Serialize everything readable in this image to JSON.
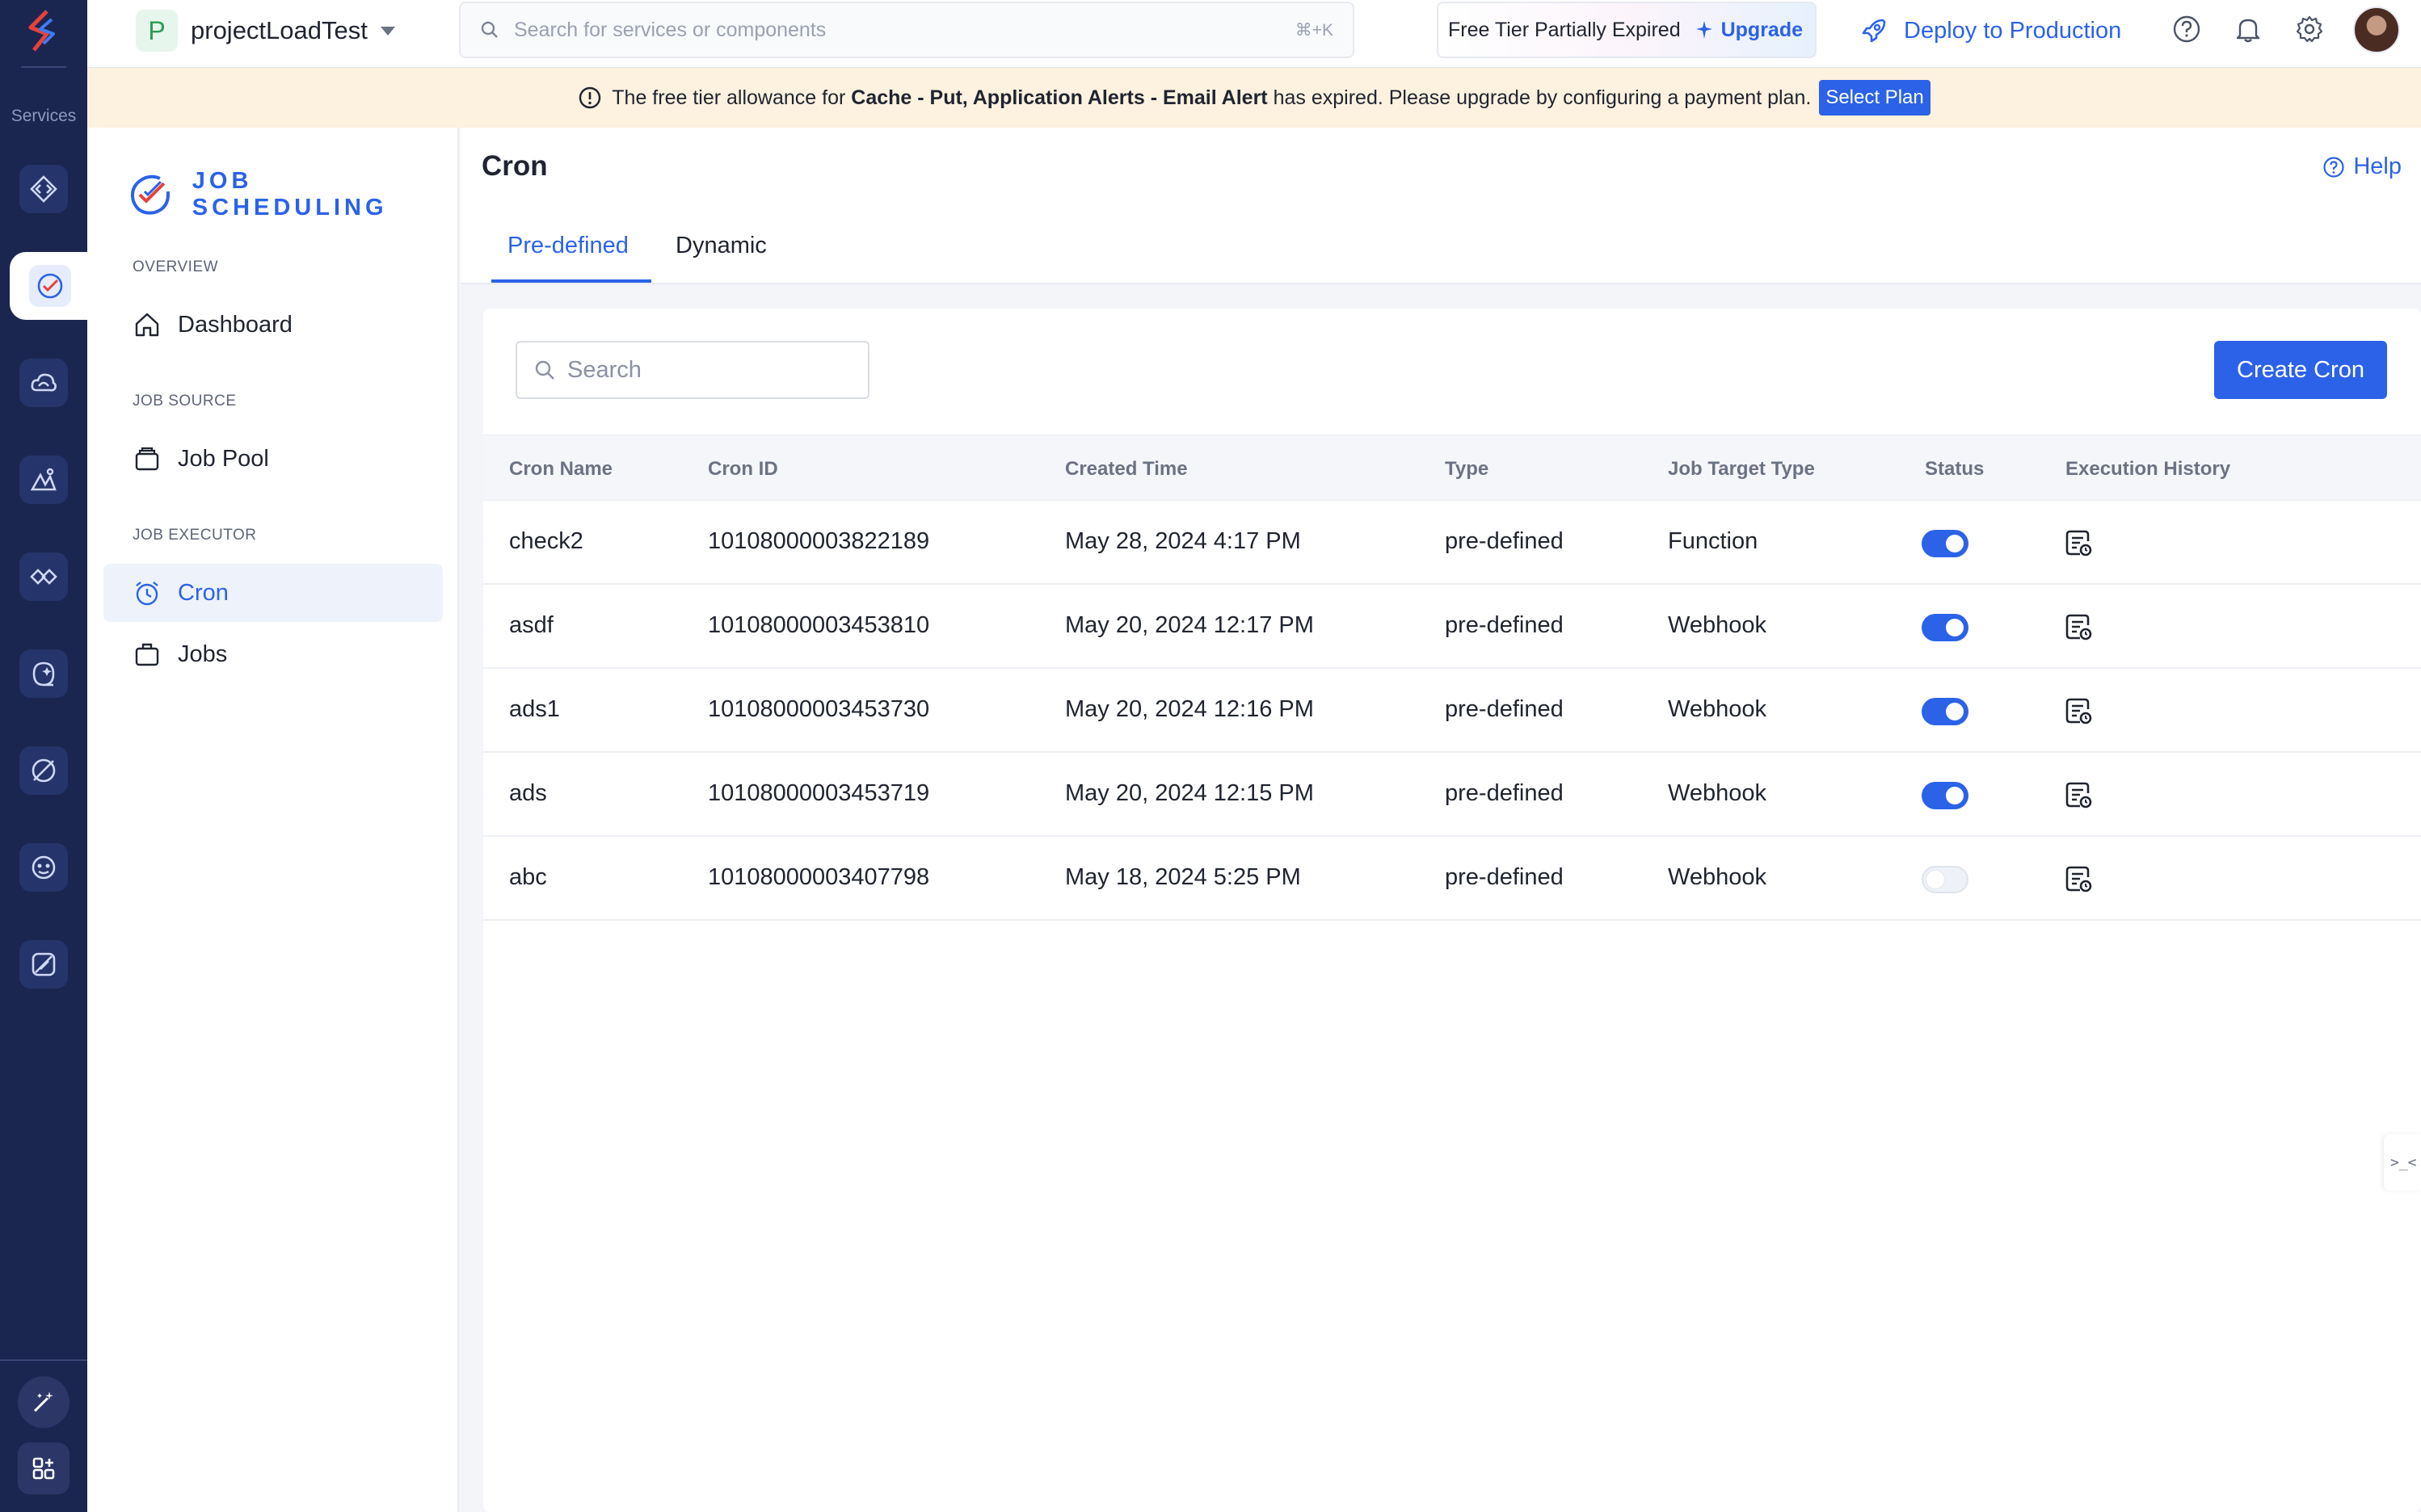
{
  "rail": {
    "services_label": "Services",
    "items": [
      "api-gateway-icon",
      "job-scheduling-icon",
      "cloud-scale-icon",
      "devops-icon",
      "integrations-icon",
      "signals-icon",
      "pipelines-icon",
      "zia-services-icon",
      "smartbrowz-icon"
    ],
    "footer": [
      "magic-wand-icon",
      "apps-grid-icon"
    ]
  },
  "topbar": {
    "project_initial": "P",
    "project_name": "projectLoadTest",
    "search_placeholder": "Search for services or components",
    "search_shortcut": "⌘+K",
    "tier_status": "Free Tier Partially Expired",
    "upgrade_label": "Upgrade",
    "deploy_label": "Deploy to Production"
  },
  "banner": {
    "prefix": "The free tier allowance for",
    "services": "Cache - Put, Application Alerts - Email Alert",
    "suffix": "has expired. Please upgrade by configuring a payment plan.",
    "button": "Select Plan"
  },
  "leftnav": {
    "brand": "JOB SCHEDULING",
    "sections": [
      {
        "title": "OVERVIEW",
        "items": [
          "Dashboard"
        ]
      },
      {
        "title": "JOB SOURCE",
        "items": [
          "Job Pool"
        ]
      },
      {
        "title": "JOB EXECUTOR",
        "items": [
          "Cron",
          "Jobs"
        ]
      }
    ],
    "active": "Cron"
  },
  "main": {
    "title": "Cron",
    "help_label": "Help",
    "tabs": [
      "Pre-defined",
      "Dynamic"
    ],
    "active_tab": "Pre-defined",
    "search_placeholder": "Search",
    "create_button": "Create Cron",
    "columns": [
      "Cron Name",
      "Cron ID",
      "Created Time",
      "Type",
      "Job Target Type",
      "Status",
      "Execution History"
    ],
    "rows": [
      {
        "name": "check2",
        "id": "10108000003822189",
        "created": "May 28, 2024 4:17 PM",
        "type": "pre-defined",
        "target": "Function",
        "enabled": true
      },
      {
        "name": "asdf",
        "id": "10108000003453810",
        "created": "May 20, 2024 12:17 PM",
        "type": "pre-defined",
        "target": "Webhook",
        "enabled": true
      },
      {
        "name": "ads1",
        "id": "10108000003453730",
        "created": "May 20, 2024 12:16 PM",
        "type": "pre-defined",
        "target": "Webhook",
        "enabled": true
      },
      {
        "name": "ads",
        "id": "10108000003453719",
        "created": "May 20, 2024 12:15 PM",
        "type": "pre-defined",
        "target": "Webhook",
        "enabled": true
      },
      {
        "name": "abc",
        "id": "10108000003407798",
        "created": "May 18, 2024 5:25 PM",
        "type": "pre-defined",
        "target": "Webhook",
        "enabled": false
      }
    ]
  },
  "side_tab": ">_<",
  "colors": {
    "accent": "#2b62e8",
    "rail": "#1b2650",
    "banner": "#fdf1df",
    "toggle_on": "#2b62e8"
  }
}
